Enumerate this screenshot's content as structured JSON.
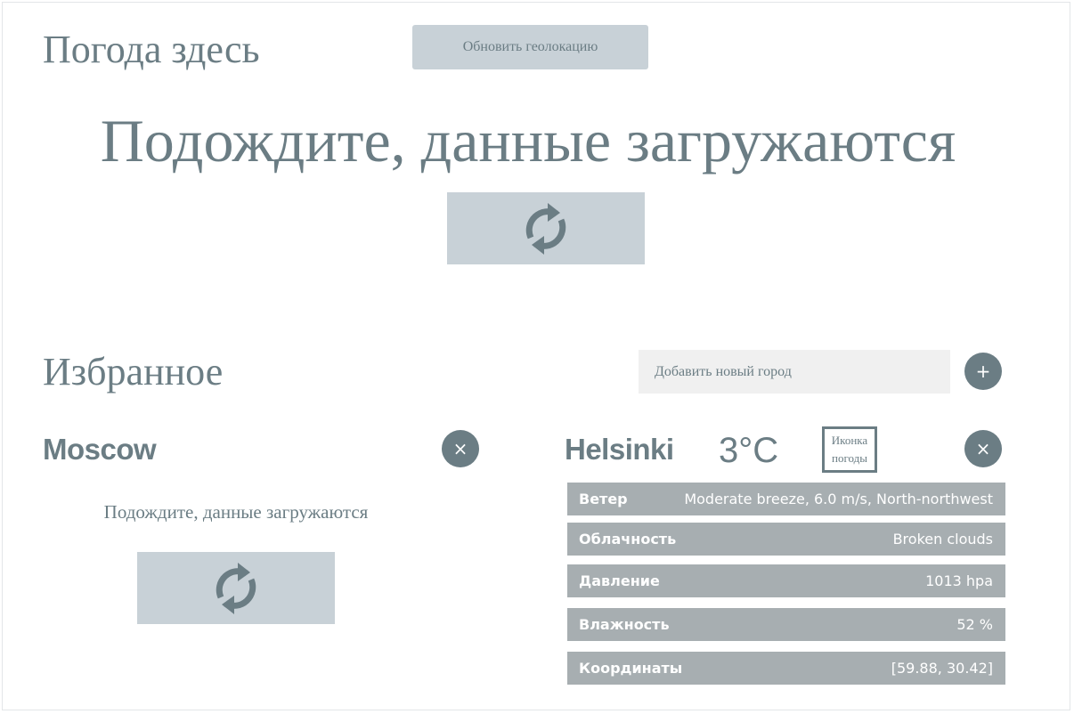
{
  "header": {
    "title": "Погода здесь",
    "update_geo_label": "Обновить геолокацию"
  },
  "current": {
    "loading_text": "Подождите, данные загружаются",
    "loader_icon": "refresh-icon"
  },
  "favorites": {
    "title": "Избранное",
    "add_placeholder": "Добавить новый город",
    "add_button_label": "+",
    "cities": [
      {
        "name": "Moscow",
        "close_label": "×",
        "loading_text": "Подождите, данные загружаются"
      },
      {
        "name": "Helsinki",
        "temperature": "3°C",
        "icon_alt": "Иконка погоды",
        "close_label": "×",
        "details": [
          {
            "label": "Ветер",
            "value": "Moderate breeze, 6.0 m/s, North-northwest"
          },
          {
            "label": "Облачность",
            "value": "Broken clouds"
          },
          {
            "label": "Давление",
            "value": "1013 hpa"
          },
          {
            "label": "Влажность",
            "value": "52 %"
          },
          {
            "label": "Координаты",
            "value": "[59.88, 30.42]"
          }
        ]
      }
    ]
  },
  "colors": {
    "text": "#6b7d84",
    "button_bg": "#c8d1d7",
    "row_bg": "#a7aeb1",
    "input_bg": "#f0f0f0"
  }
}
